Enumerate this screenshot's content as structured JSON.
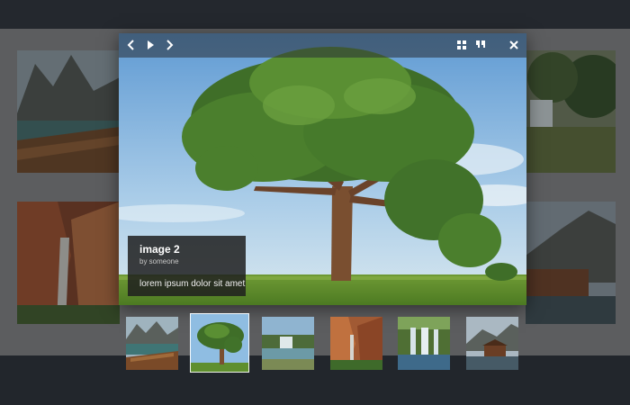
{
  "lightbox": {
    "caption": {
      "title": "image 2",
      "author": "by someone",
      "description": "lorem ipsum dolor sit amet"
    },
    "toolbar": {
      "left_icons": [
        "chevron-left-icon",
        "play-icon",
        "chevron-right-icon"
      ],
      "right_icons": [
        "grid-icon",
        "quote-icon",
        "close-icon"
      ]
    },
    "current_image": "tree-in-meadow"
  },
  "thumbnails": [
    {
      "image": "lake-mountains-boat",
      "active": false
    },
    {
      "image": "tree-in-meadow",
      "active": true
    },
    {
      "image": "river-waterfall",
      "active": false
    },
    {
      "image": "red-rock-canyon",
      "active": false
    },
    {
      "image": "waterfall-forest",
      "active": false
    },
    {
      "image": "lakeside-cabin",
      "active": false
    }
  ],
  "colors": {
    "background": "#22262c",
    "gallery_backdrop": "#5c5d5f",
    "toolbar_overlay": "#2d3138",
    "caption_box": "#1e1e1e"
  }
}
